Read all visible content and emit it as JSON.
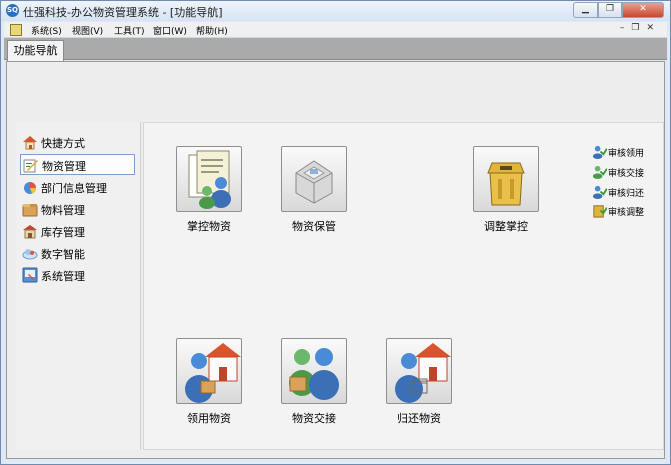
{
  "window": {
    "title": "仕强科技-办公物资管理系统 - [功能导航]",
    "app_icon_text": "SQ"
  },
  "menubar": {
    "items": [
      {
        "label": "系统(S)"
      },
      {
        "label": "视图(V)"
      },
      {
        "label": "工具(T)"
      },
      {
        "label": "窗口(W)"
      },
      {
        "label": "帮助(H)"
      }
    ]
  },
  "tabs": [
    {
      "label": "功能导航"
    }
  ],
  "sidebar": {
    "items": [
      {
        "label": "快捷方式",
        "icon": "house-icon"
      },
      {
        "label": "物资管理",
        "icon": "edit-icon",
        "selected": true
      },
      {
        "label": "部门信息管理",
        "icon": "chart-icon"
      },
      {
        "label": "物料管理",
        "icon": "box-icon"
      },
      {
        "label": "库存管理",
        "icon": "warehouse-icon"
      },
      {
        "label": "数字智能",
        "icon": "cloud-icon"
      },
      {
        "label": "系统管理",
        "icon": "settings-icon"
      }
    ]
  },
  "main": {
    "tiles": [
      {
        "label": "掌控物资",
        "icon": "documents-user-icon"
      },
      {
        "label": "物资保管",
        "icon": "safe-box-icon"
      },
      {
        "label": "调整掌控",
        "icon": "trash-bin-icon"
      },
      {
        "label": "领用物资",
        "icon": "user-house-icon"
      },
      {
        "label": "物资交接",
        "icon": "users-handover-icon"
      },
      {
        "label": "归还物资",
        "icon": "user-return-icon"
      }
    ],
    "audit_links": [
      {
        "label": "审核领用"
      },
      {
        "label": "审核交接"
      },
      {
        "label": "审核归还"
      },
      {
        "label": "审核调整"
      }
    ]
  },
  "colors": {
    "accent": "#3b6fb6",
    "tab_strip": "#aaaaaa",
    "content_bg": "#ededed"
  }
}
